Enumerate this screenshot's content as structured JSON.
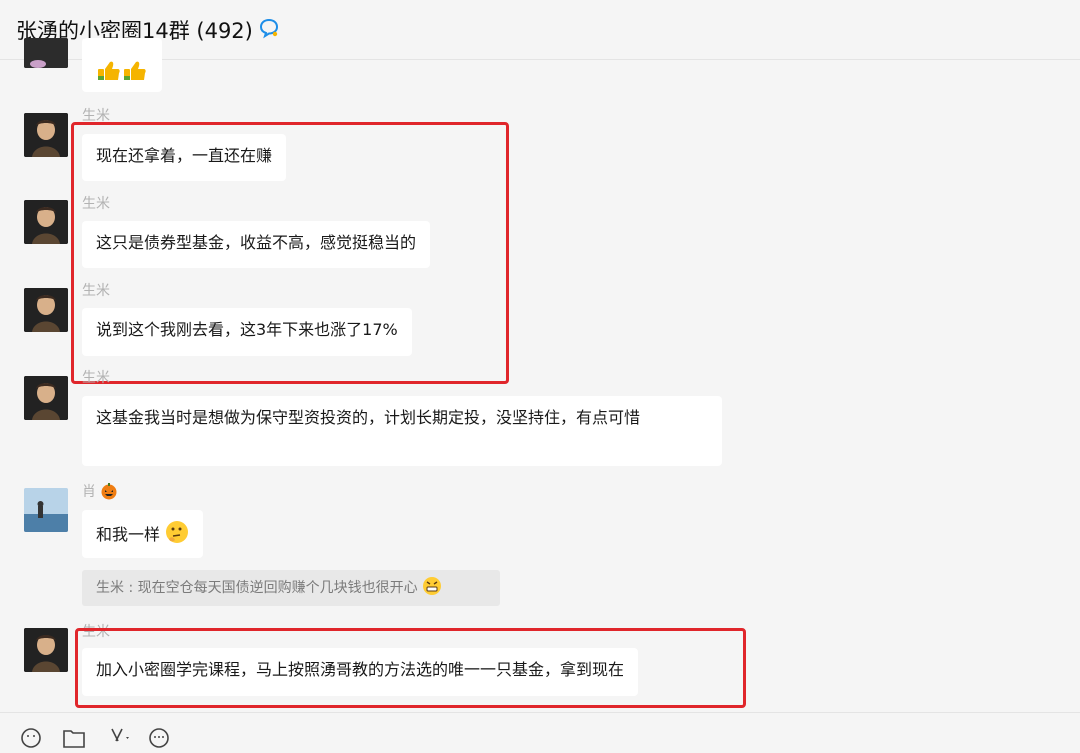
{
  "header": {
    "title": "张湧的小密圈14群 (492)"
  },
  "messages": [
    {
      "sender": "生米",
      "text": "现在还拿着，一直还在赚"
    },
    {
      "sender": "生米",
      "text": "这只是债券型基金，收益不高，感觉挺稳当的"
    },
    {
      "sender": "生米",
      "text": "说到这个我刚去看，这3年下来也涨了17%"
    },
    {
      "sender": "生米",
      "text": "这基金我当时是想做为保守型资投资的，计划长期定投，没坚持住，有点可惜"
    },
    {
      "sender": "肖",
      "text": "和我一样"
    },
    {
      "sender": "生米",
      "text": "加入小密圈学完课程，马上按照湧哥教的方法选的唯一一只基金，拿到现在"
    }
  ],
  "quote": {
    "text": "生米 : 现在空仓每天国债逆回购赚个几块钱也很开心"
  },
  "icons": {
    "title_icon": "chat-bubble-icon",
    "toolbar": [
      "emoji-icon",
      "folder-icon",
      "scissors-icon",
      "chat-history-icon"
    ]
  },
  "colors": {
    "highlight": "#e0262b",
    "background": "#f5f5f5",
    "bubble": "#ffffff"
  }
}
